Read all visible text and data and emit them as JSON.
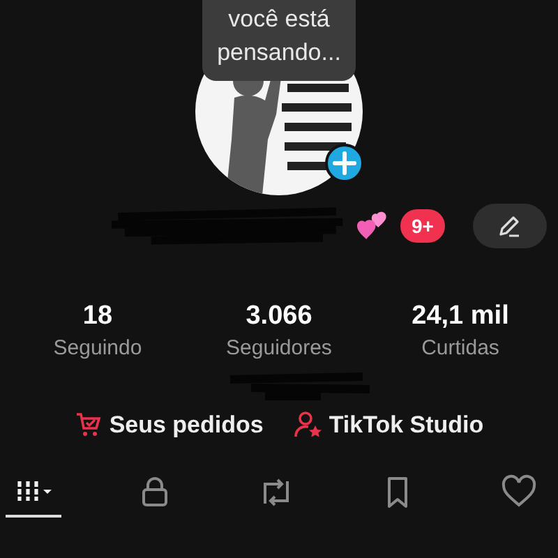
{
  "note": {
    "text": "você está pensando..."
  },
  "profile": {
    "badge": "9+"
  },
  "stats": [
    {
      "value": "18",
      "label": "Seguindo"
    },
    {
      "value": "3.066",
      "label": "Seguidores"
    },
    {
      "value": "24,1 mil",
      "label": "Curtidas"
    }
  ],
  "links": [
    {
      "kind": "orders",
      "label": "Seus pedidos"
    },
    {
      "kind": "studio",
      "label": "TikTok Studio"
    }
  ],
  "tabs": [
    {
      "kind": "grid",
      "selected": true
    },
    {
      "kind": "lock",
      "selected": false
    },
    {
      "kind": "repost",
      "selected": false
    },
    {
      "kind": "bookmark",
      "selected": false
    },
    {
      "kind": "heart",
      "selected": false
    }
  ]
}
